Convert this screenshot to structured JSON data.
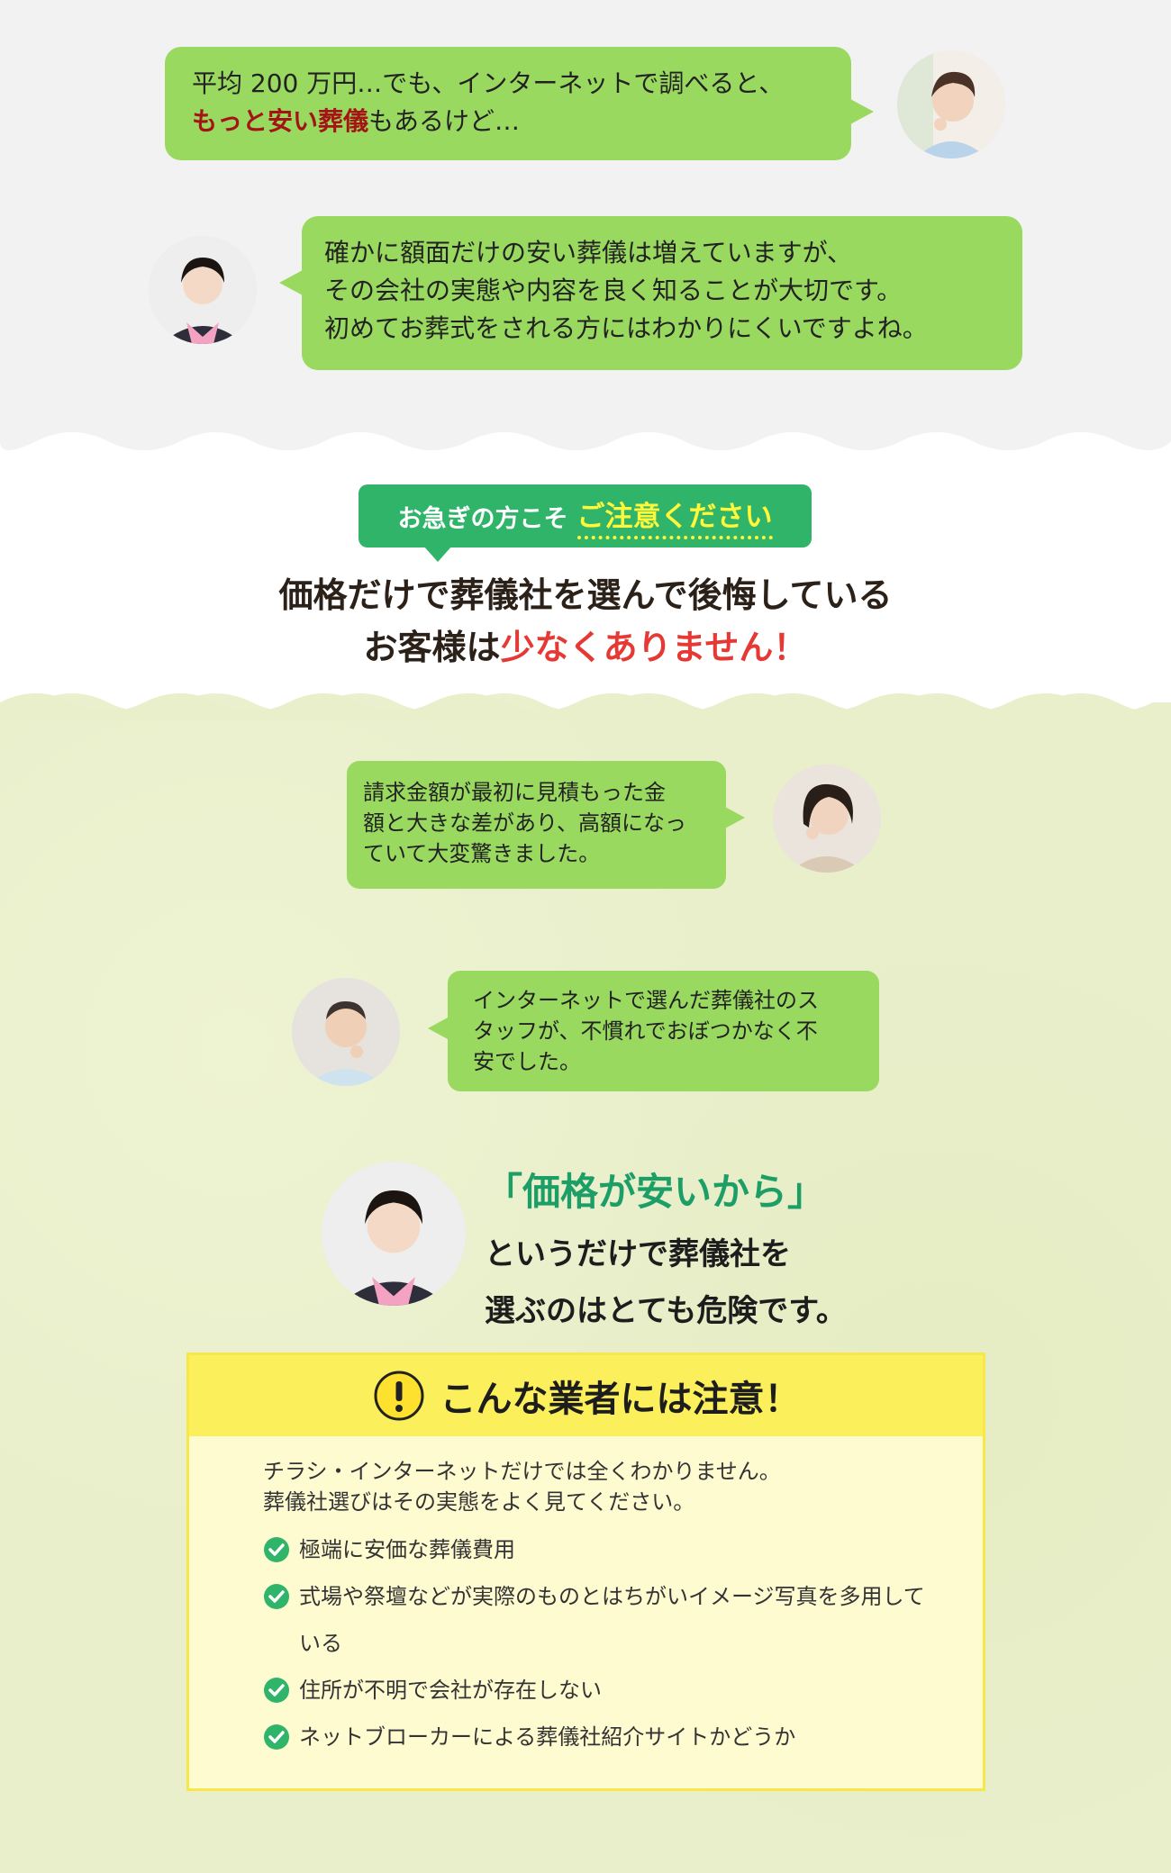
{
  "conversation_top": {
    "q1": {
      "pre": "平均 200 万円…でも、インターネットで調べると、",
      "em": "もっと安い葬儀",
      "post": "もあるけど…"
    },
    "a1": {
      "lines": [
        "確かに額面だけの安い葬儀は増えていますが、",
        "その会社の実態や内容を良く知ることが大切です。",
        "初めてお葬式をされる方にはわかりにくいですよね。"
      ]
    }
  },
  "notice_tag": {
    "prefix": "お急ぎの方こそ",
    "highlight": "ご注意ください"
  },
  "headline": {
    "line1": "価格だけで葬儀社を選んで後悔している",
    "line2_pre": "お客様は",
    "line2_em": "少なくありません！"
  },
  "testimonials": [
    {
      "lines": [
        "請求金額が最初に見積もった金",
        "額と大きな差があり、高額になっ",
        "ていて大変驚きました。"
      ]
    },
    {
      "lines": [
        "インターネットで選んだ葬儀社のス",
        "タッフが、不慣れでおぼつかなく不",
        "安でした。"
      ]
    }
  ],
  "advice": {
    "line1": "「価格が安いから」",
    "line2": "というだけで葬儀社を",
    "line3": "選ぶのはとても危険です。"
  },
  "warning": {
    "title": "こんな業者には注意！",
    "intro": [
      "チラシ・インターネットだけでは全くわかりません。",
      "葬儀社選びはその実態をよく見てください。"
    ],
    "items": [
      "極端に安価な葬儀費用",
      "式場や祭壇などが実際のものとはちがいイメージ写真を多用している",
      "住所が不明で会社が存在しない",
      "ネットブローカーによる葬儀社紹介サイトかどうか"
    ]
  },
  "colors": {
    "bubble": "#9ad95f",
    "tag": "#2fb46a",
    "accent_red": "#e53935",
    "quote_green": "#1e9e67",
    "warning_bg": "#fffbd1",
    "warning_head": "#fcef5c"
  }
}
